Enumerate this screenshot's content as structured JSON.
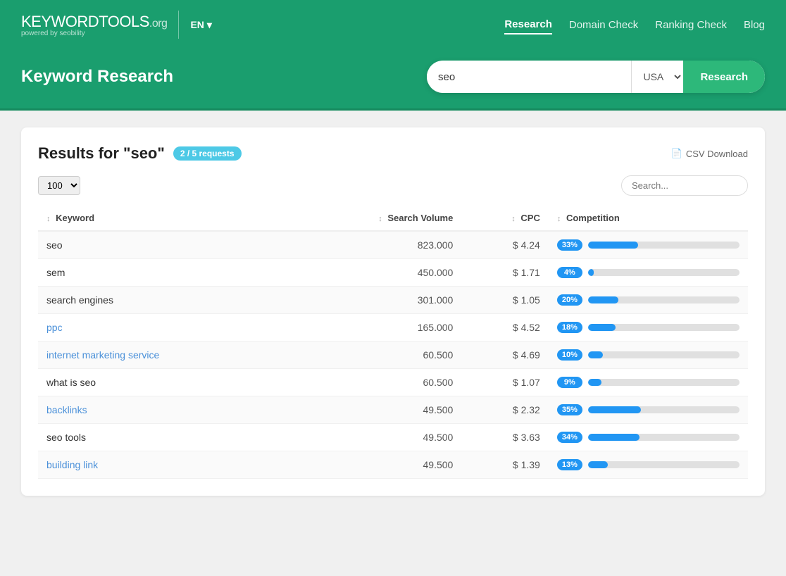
{
  "brand": {
    "name_bold": "KEYWORD",
    "name_regular": "TOOLS",
    "name_org": ".org",
    "powered": "powered by seobility",
    "divider": true
  },
  "lang": {
    "label": "EN",
    "arrow": "▾"
  },
  "nav": {
    "items": [
      {
        "label": "Research",
        "active": true
      },
      {
        "label": "Domain Check",
        "active": false
      },
      {
        "label": "Ranking Check",
        "active": false
      },
      {
        "label": "Blog",
        "active": false
      }
    ]
  },
  "search_banner": {
    "title": "Keyword Research",
    "search_value": "seo",
    "country_value": "USA",
    "button_label": "Research",
    "search_placeholder": "seo"
  },
  "results": {
    "prefix": "Results for",
    "query": "\"seo\"",
    "badge": "2 / 5 requests",
    "csv_label": "CSV Download",
    "per_page": "100",
    "search_placeholder": "Search...",
    "columns": [
      "Keyword",
      "Search Volume",
      "CPC",
      "Competition"
    ],
    "rows": [
      {
        "keyword": "seo",
        "is_link": false,
        "volume": "823.000",
        "cpc": "$ 4.24",
        "comp_pct": 33,
        "comp_label": "33%"
      },
      {
        "keyword": "sem",
        "is_link": false,
        "volume": "450.000",
        "cpc": "$ 1.71",
        "comp_pct": 4,
        "comp_label": "4%"
      },
      {
        "keyword": "search engines",
        "is_link": false,
        "volume": "301.000",
        "cpc": "$ 1.05",
        "comp_pct": 20,
        "comp_label": "20%"
      },
      {
        "keyword": "ppc",
        "is_link": true,
        "volume": "165.000",
        "cpc": "$ 4.52",
        "comp_pct": 18,
        "comp_label": "18%"
      },
      {
        "keyword": "internet marketing service",
        "is_link": true,
        "volume": "60.500",
        "cpc": "$ 4.69",
        "comp_pct": 10,
        "comp_label": "10%"
      },
      {
        "keyword": "what is seo",
        "is_link": false,
        "volume": "60.500",
        "cpc": "$ 1.07",
        "comp_pct": 9,
        "comp_label": "9%"
      },
      {
        "keyword": "backlinks",
        "is_link": true,
        "volume": "49.500",
        "cpc": "$ 2.32",
        "comp_pct": 35,
        "comp_label": "35%"
      },
      {
        "keyword": "seo tools",
        "is_link": false,
        "volume": "49.500",
        "cpc": "$ 3.63",
        "comp_pct": 34,
        "comp_label": "34%"
      },
      {
        "keyword": "building link",
        "is_link": true,
        "volume": "49.500",
        "cpc": "$ 1.39",
        "comp_pct": 13,
        "comp_label": "13%"
      }
    ]
  }
}
